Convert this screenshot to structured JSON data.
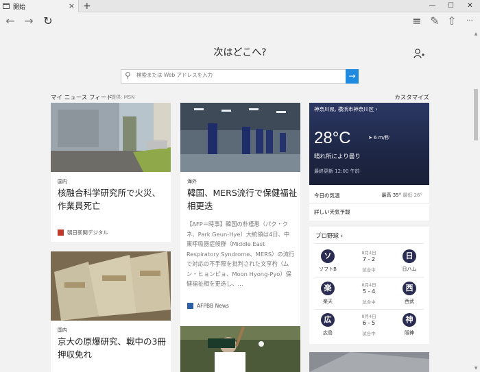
{
  "tab": {
    "title": "開始",
    "close": "×",
    "new_tab": "+"
  },
  "window": {
    "minimize": "—",
    "maximize": "☐",
    "close": "✕"
  },
  "nav": {
    "back": "←",
    "forward": "→",
    "refresh": "↻",
    "hub": "≡",
    "note": "✎",
    "share": "⇧",
    "more": "···"
  },
  "headline": "次はどこへ?",
  "search": {
    "placeholder": "検索または Web アドレスを入力",
    "go": "→"
  },
  "feed": {
    "title": "マイ ニュース フィード",
    "provider": "提供: MSN",
    "customize": "カスタマイズ"
  },
  "cards": [
    {
      "category": "国内",
      "title_line1": "核融合科学研究所で火災、",
      "title_line2": "作業員死亡",
      "source": "朝日新聞デジタル"
    },
    {
      "category": "海外",
      "title_line1": "韓国、MERS流行で保健福祉",
      "title_line2": "相更迭",
      "excerpt": "【AFP＝時事】韓国の朴槿恵（パク・クネ、Park Geun-Hye）大統領は4日、中東呼吸器症候群（Middle East Respiratory Syndrome、MERS）の流行で対応の不手際を批判された文亨杓（ムン・ヒョンピョ、Moon Hyong-Pyo）保健福祉相を更迭し、...",
      "source": "AFPBB News"
    },
    {
      "category": "国内",
      "title_line1": "京大の原爆研究、戦中の3冊",
      "title_line2": "押収免れ"
    }
  ],
  "weather": {
    "location": "神奈川県, 横浜市神奈川区  ›",
    "temp": "28°C",
    "wind": "➤ 6 m/秒",
    "condition": "晴れ所により曇り",
    "updated": "最終更新 12:00 午前",
    "today_label": "今日の気温",
    "high": "最高 35°",
    "low": "最低 26°",
    "detail": "詳しい天気予報"
  },
  "baseball": {
    "title": "プロ野球  ›",
    "games": [
      {
        "home_logo": "ソ",
        "home": "ソフトB",
        "away_logo": "日",
        "away": "日ハム",
        "date": "8月4日",
        "score": "7 - 2",
        "status": "試合中"
      },
      {
        "home_logo": "楽",
        "home": "楽天",
        "away_logo": "西",
        "away": "西武",
        "date": "8月4日",
        "score": "5 - 4",
        "status": "試合中"
      },
      {
        "home_logo": "広",
        "home": "広島",
        "away_logo": "神",
        "away": "阪神",
        "date": "8月4日",
        "score": "6 - 5",
        "status": "試合中"
      }
    ]
  },
  "colors": {
    "accent": "#1e8be0",
    "weather_bg": "#1f2a4a",
    "team_logo": "#2a2c52"
  }
}
